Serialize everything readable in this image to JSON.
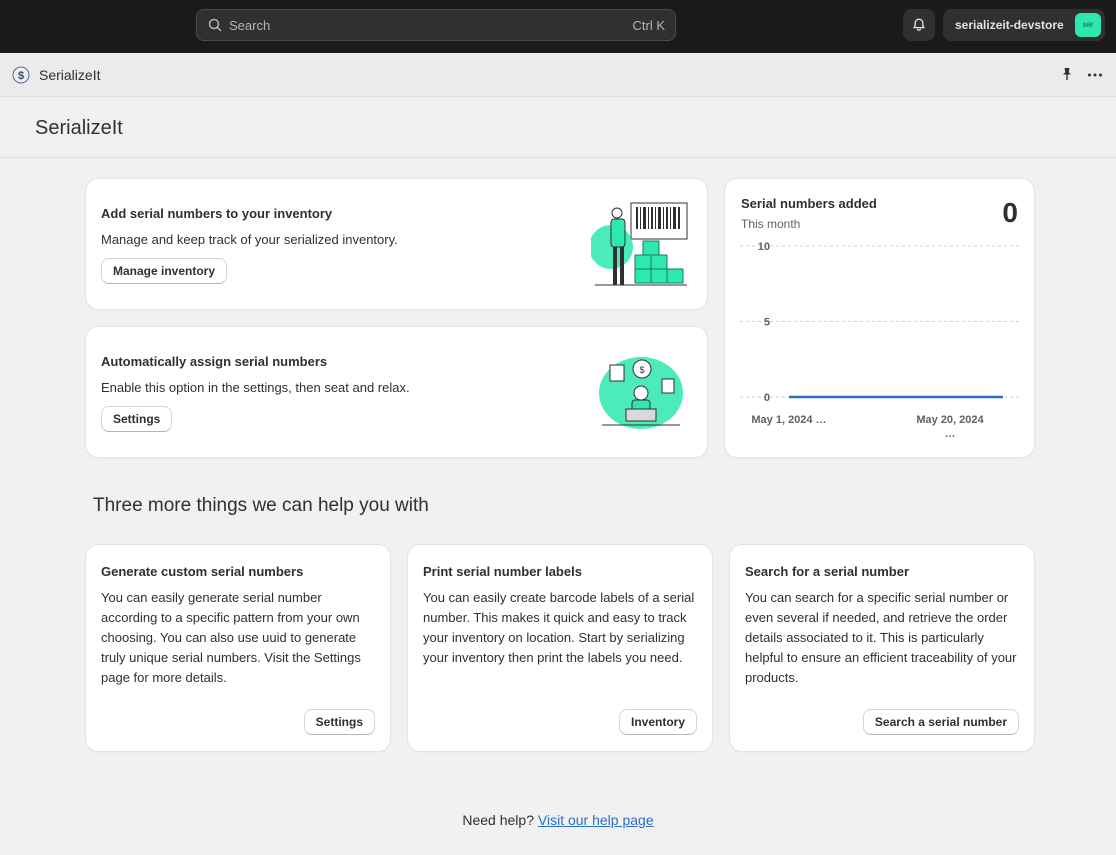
{
  "topbar": {
    "search_placeholder": "Search",
    "search_shortcut": "Ctrl K",
    "store_name": "serializeit-devstore",
    "store_avatar": "ser"
  },
  "appbar": {
    "app_name": "SerializeIt"
  },
  "page": {
    "title": "SerializeIt"
  },
  "cards": {
    "inventory": {
      "title": "Add serial numbers to your inventory",
      "text": "Manage and keep track of your serialized inventory.",
      "button": "Manage inventory"
    },
    "auto": {
      "title": "Automatically assign serial numbers",
      "text": "Enable this option in the settings, then seat and relax.",
      "button": "Settings"
    }
  },
  "chart_card": {
    "title": "Serial numbers added",
    "subtitle": "This month",
    "total": "0"
  },
  "chart_data": {
    "type": "line",
    "x": [
      "May 1, 2024 …",
      "May 20, 2024 …"
    ],
    "y_ticks": [
      "0",
      "5",
      "10"
    ],
    "series": [
      {
        "values": [
          0,
          0
        ]
      }
    ],
    "ylim": [
      0,
      10
    ],
    "grid": true,
    "color": "#2c6ecb"
  },
  "section": {
    "heading": "Three more things we can help you with"
  },
  "help_cards": [
    {
      "title": "Generate custom serial numbers",
      "text": "You can easily generate serial number according to a specific pattern from your own choosing. You can also use uuid to generate truly unique serial numbers. Visit the Settings page for more details.",
      "button": "Settings"
    },
    {
      "title": "Print serial number labels",
      "text": "You can easily create barcode labels of a serial number. This makes it quick and easy to track your inventory on location. Start by serializing your inventory then print the labels you need.",
      "button": "Inventory"
    },
    {
      "title": "Search for a serial number",
      "text": "You can search for a specific serial number or even several if needed, and retrieve the order details associated to it. This is particularly helpful to ensure an efficient traceability of your products.",
      "button": "Search a serial number"
    }
  ],
  "footer": {
    "help_text": "Need help?",
    "help_link": "Visit our help page"
  },
  "colors": {
    "accent_green": "#2de8b0",
    "link": "#2c6ecb",
    "topbar": "#1a1a1a"
  }
}
